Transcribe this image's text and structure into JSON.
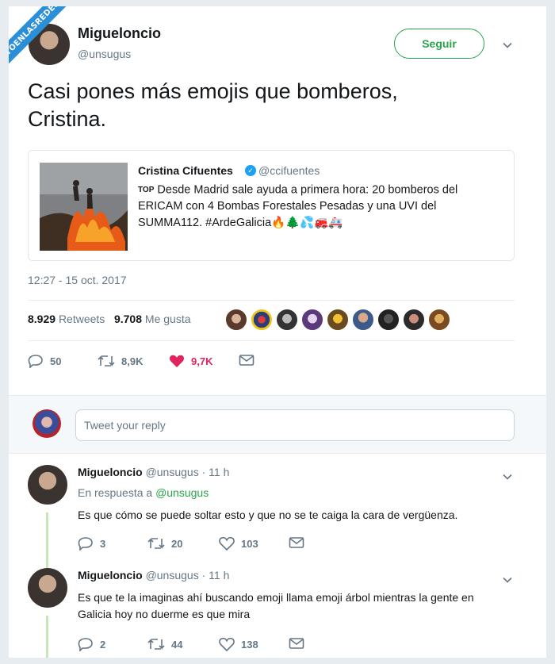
{
  "watermark": "VISTOENLASREDES.com",
  "tweet": {
    "author_name": "Migueloncio",
    "author_handle": "@unsugus",
    "follow_label": "Seguir",
    "text_line1": "Casi pones más emojis que bomberos,",
    "text_line2": "Cristina.",
    "timestamp": "12:27 - 15 oct. 2017",
    "retweets_count": "8.929",
    "retweets_label": "Retweets",
    "likes_count": "9.708",
    "likes_label": "Me gusta",
    "actions": {
      "replies": "50",
      "retweets": "8,9K",
      "likes": "9,7K"
    }
  },
  "quote": {
    "author_name": "Cristina Cifuentes",
    "author_handle": "@ccifuentes",
    "top_badge": "TOP",
    "line1": " Desde Madrid sale ayuda a primera hora: 20 bomberos del",
    "line2": "ERICAM con 4 Bombas Forestales Pesadas y una UVI del",
    "line3": "SUMMA112. #ArdeGalicia",
    "emojis": "🔥🌲💦🚒🚑"
  },
  "reply_box": {
    "placeholder": "Tweet your reply"
  },
  "replies": [
    {
      "name": "Migueloncio",
      "meta": "@unsugus · 11 h",
      "in_reply_prefix": "En respuesta a ",
      "in_reply_handle": "@unsugus",
      "text": "Es que cómo se puede soltar esto y que no se te caiga la cara de vergüenza.",
      "replies": "3",
      "retweets": "20",
      "likes": "103"
    },
    {
      "name": "Migueloncio",
      "meta": "@unsugus · 11 h",
      "text_line1": "Es que te la imaginas ahí buscando emoji llama emoji árbol mientras la gente en",
      "text_line2": "Galicia hoy no duerme es que mira",
      "replies": "2",
      "retweets": "44",
      "likes": "138"
    }
  ],
  "colors": {
    "accent_green": "#2aa34a",
    "like_red": "#e0245e",
    "muted": "#657786"
  },
  "icons": [
    "reply-icon",
    "retweet-icon",
    "heart-icon",
    "mail-icon",
    "chevron-down-icon",
    "verified-icon"
  ]
}
